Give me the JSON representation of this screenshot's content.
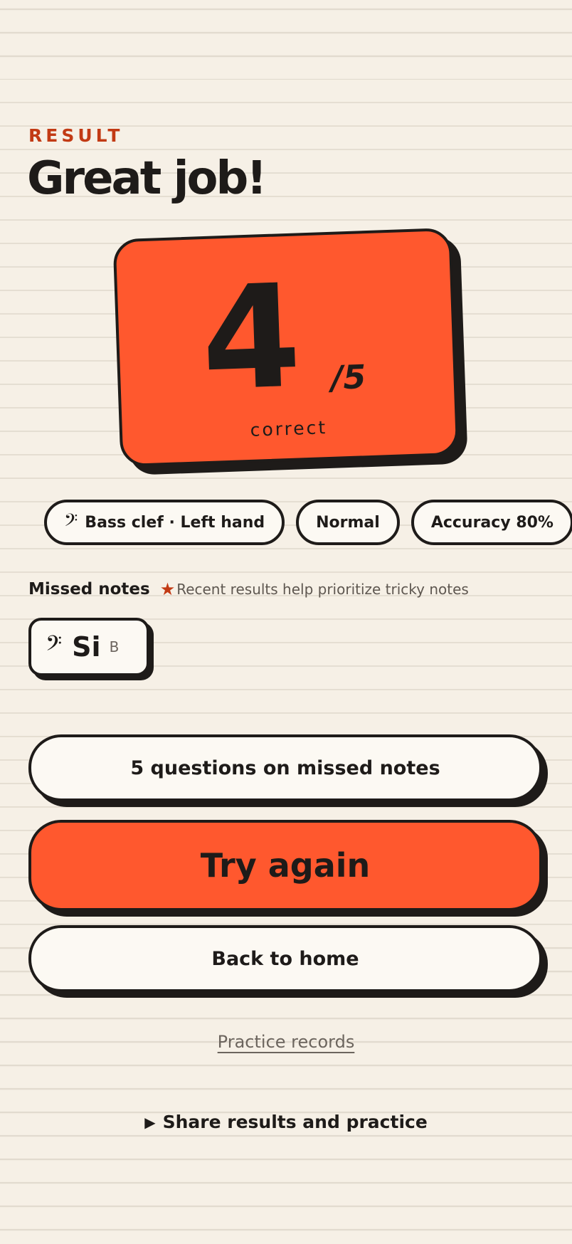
{
  "header": {
    "eyebrow": "RESULT",
    "title": "Great job!"
  },
  "score": {
    "correct": "4",
    "total": "/5",
    "label": "correct",
    "card_color": "#ff582e"
  },
  "chips": [
    {
      "icon": "bass-clef-icon",
      "glyph": "𝄢",
      "label": "Bass clef · Left hand"
    },
    {
      "label": "Normal"
    },
    {
      "label": "Accuracy 80%"
    }
  ],
  "missed": {
    "title": "Missed notes",
    "hint_icon": "star-icon",
    "hint": "Recent results help prioritize tricky notes",
    "notes": [
      {
        "clef_icon": "bass-clef-icon",
        "glyph": "𝄢",
        "name": "Si",
        "letter": "B"
      }
    ]
  },
  "actions": {
    "missed_practice": "5 questions on missed notes",
    "try_again": "Try again",
    "home": "Back to home",
    "records": "Practice records",
    "share_icon": "play-icon",
    "share_glyph": "▶",
    "share": "Share results and practice"
  },
  "colors": {
    "accent": "#ff582e",
    "accent_dark": "#c23a14",
    "ink": "#1e1b19",
    "background": "#f6f0e6"
  }
}
